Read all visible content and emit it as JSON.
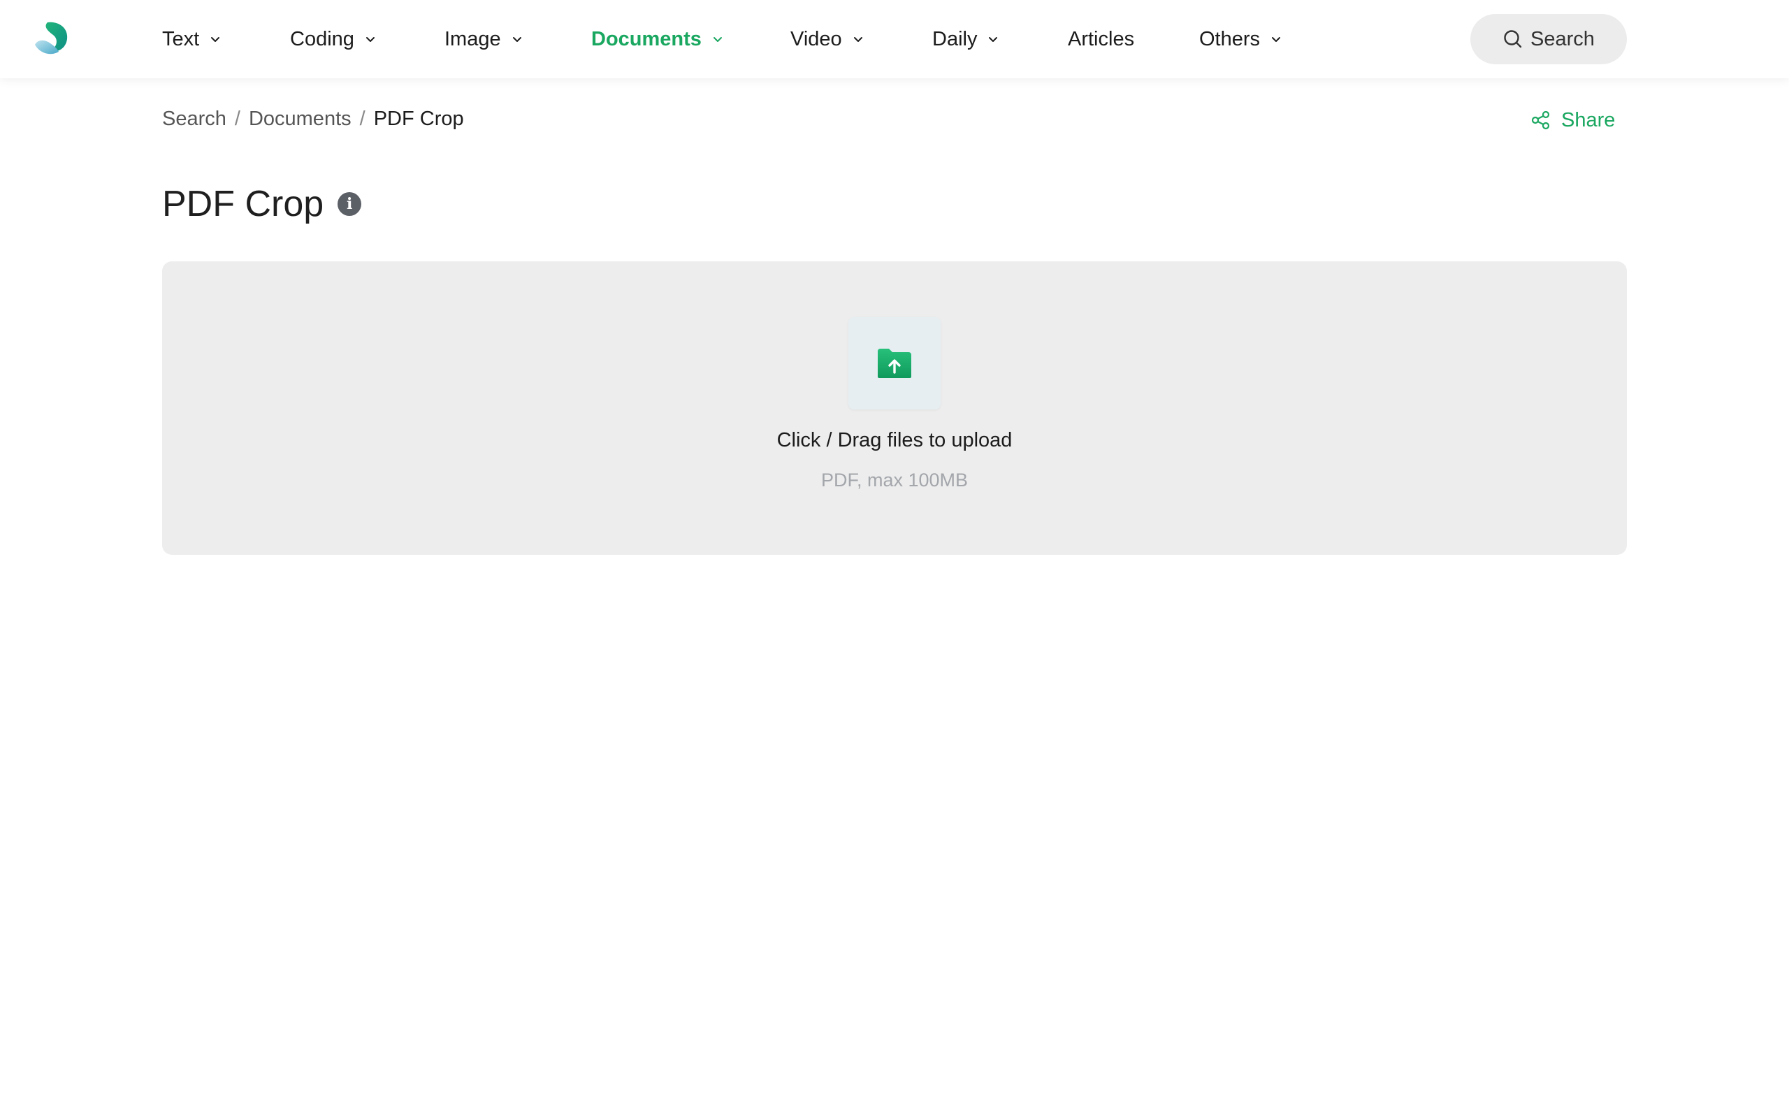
{
  "nav": {
    "items": [
      {
        "label": "Text",
        "has_dropdown": true,
        "active": false
      },
      {
        "label": "Coding",
        "has_dropdown": true,
        "active": false
      },
      {
        "label": "Image",
        "has_dropdown": true,
        "active": false
      },
      {
        "label": "Documents",
        "has_dropdown": true,
        "active": true
      },
      {
        "label": "Video",
        "has_dropdown": true,
        "active": false
      },
      {
        "label": "Daily",
        "has_dropdown": true,
        "active": false
      },
      {
        "label": "Articles",
        "has_dropdown": false,
        "active": false
      },
      {
        "label": "Others",
        "has_dropdown": true,
        "active": false
      }
    ],
    "search_label": "Search"
  },
  "breadcrumb": {
    "items": [
      "Search",
      "Documents",
      "PDF Crop"
    ],
    "separator": "/"
  },
  "share_label": "Share",
  "page": {
    "title": "PDF Crop",
    "info_icon_glyph": "i"
  },
  "upload": {
    "primary_text": "Click / Drag files to upload",
    "secondary_text": "PDF, max 100MB"
  },
  "icons": {
    "logo": "brand-logo",
    "search": "search-icon",
    "share": "share-icon",
    "info": "info-icon",
    "upload": "folder-upload-icon",
    "dropdown": "chevron-down-icon"
  },
  "colors": {
    "accent": "#1aa760",
    "nav_text": "#1c1c1c",
    "dropzone_bg": "#ededed",
    "muted_text": "#a3a6ab"
  }
}
